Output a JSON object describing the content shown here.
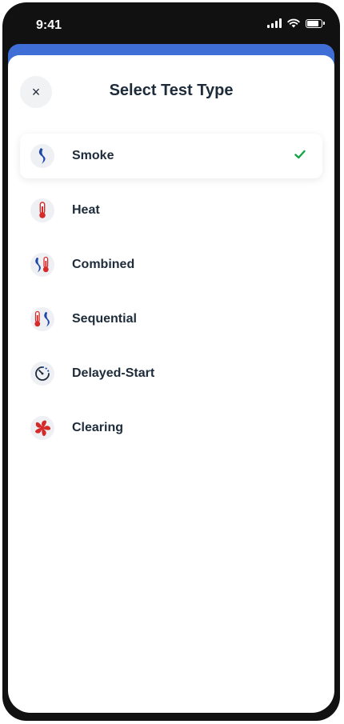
{
  "status": {
    "time": "9:41"
  },
  "header": {
    "title": "Select Test Type",
    "close_label": "×"
  },
  "items": [
    {
      "label": "Smoke",
      "icon": "smoke-icon",
      "selected": true
    },
    {
      "label": "Heat",
      "icon": "thermometer-icon",
      "selected": false
    },
    {
      "label": "Combined",
      "icon": "smoke-heat-icon",
      "selected": false
    },
    {
      "label": "Sequential",
      "icon": "heat-smoke-icon",
      "selected": false
    },
    {
      "label": "Delayed-Start",
      "icon": "timer-icon",
      "selected": false
    },
    {
      "label": "Clearing",
      "icon": "fan-icon",
      "selected": false
    }
  ],
  "colors": {
    "accent_blue": "#3f6fd6",
    "smoke_blue": "#1e47a8",
    "heat_red": "#d42a2a",
    "check_green": "#16a34a",
    "text": "#1d2b3a"
  }
}
